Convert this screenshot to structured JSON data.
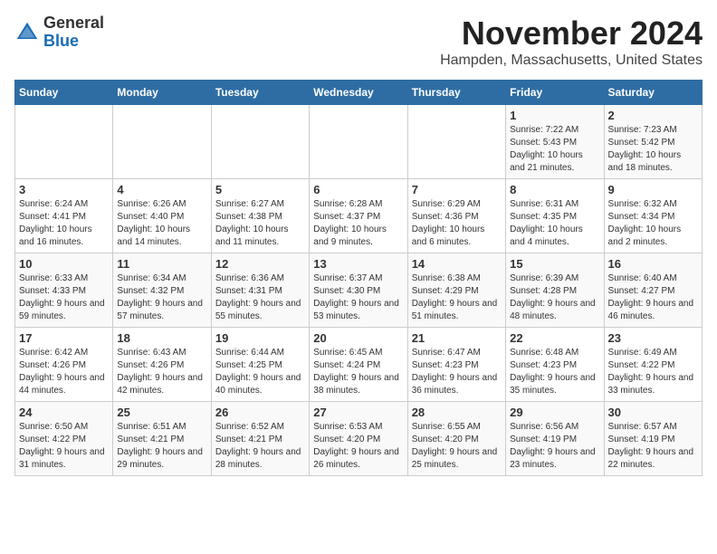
{
  "header": {
    "logo_general": "General",
    "logo_blue": "Blue",
    "month_title": "November 2024",
    "location": "Hampden, Massachusetts, United States"
  },
  "days_of_week": [
    "Sunday",
    "Monday",
    "Tuesday",
    "Wednesday",
    "Thursday",
    "Friday",
    "Saturday"
  ],
  "weeks": [
    [
      {
        "day": "",
        "info": ""
      },
      {
        "day": "",
        "info": ""
      },
      {
        "day": "",
        "info": ""
      },
      {
        "day": "",
        "info": ""
      },
      {
        "day": "",
        "info": ""
      },
      {
        "day": "1",
        "info": "Sunrise: 7:22 AM\nSunset: 5:43 PM\nDaylight: 10 hours and 21 minutes."
      },
      {
        "day": "2",
        "info": "Sunrise: 7:23 AM\nSunset: 5:42 PM\nDaylight: 10 hours and 18 minutes."
      }
    ],
    [
      {
        "day": "3",
        "info": "Sunrise: 6:24 AM\nSunset: 4:41 PM\nDaylight: 10 hours and 16 minutes."
      },
      {
        "day": "4",
        "info": "Sunrise: 6:26 AM\nSunset: 4:40 PM\nDaylight: 10 hours and 14 minutes."
      },
      {
        "day": "5",
        "info": "Sunrise: 6:27 AM\nSunset: 4:38 PM\nDaylight: 10 hours and 11 minutes."
      },
      {
        "day": "6",
        "info": "Sunrise: 6:28 AM\nSunset: 4:37 PM\nDaylight: 10 hours and 9 minutes."
      },
      {
        "day": "7",
        "info": "Sunrise: 6:29 AM\nSunset: 4:36 PM\nDaylight: 10 hours and 6 minutes."
      },
      {
        "day": "8",
        "info": "Sunrise: 6:31 AM\nSunset: 4:35 PM\nDaylight: 10 hours and 4 minutes."
      },
      {
        "day": "9",
        "info": "Sunrise: 6:32 AM\nSunset: 4:34 PM\nDaylight: 10 hours and 2 minutes."
      }
    ],
    [
      {
        "day": "10",
        "info": "Sunrise: 6:33 AM\nSunset: 4:33 PM\nDaylight: 9 hours and 59 minutes."
      },
      {
        "day": "11",
        "info": "Sunrise: 6:34 AM\nSunset: 4:32 PM\nDaylight: 9 hours and 57 minutes."
      },
      {
        "day": "12",
        "info": "Sunrise: 6:36 AM\nSunset: 4:31 PM\nDaylight: 9 hours and 55 minutes."
      },
      {
        "day": "13",
        "info": "Sunrise: 6:37 AM\nSunset: 4:30 PM\nDaylight: 9 hours and 53 minutes."
      },
      {
        "day": "14",
        "info": "Sunrise: 6:38 AM\nSunset: 4:29 PM\nDaylight: 9 hours and 51 minutes."
      },
      {
        "day": "15",
        "info": "Sunrise: 6:39 AM\nSunset: 4:28 PM\nDaylight: 9 hours and 48 minutes."
      },
      {
        "day": "16",
        "info": "Sunrise: 6:40 AM\nSunset: 4:27 PM\nDaylight: 9 hours and 46 minutes."
      }
    ],
    [
      {
        "day": "17",
        "info": "Sunrise: 6:42 AM\nSunset: 4:26 PM\nDaylight: 9 hours and 44 minutes."
      },
      {
        "day": "18",
        "info": "Sunrise: 6:43 AM\nSunset: 4:26 PM\nDaylight: 9 hours and 42 minutes."
      },
      {
        "day": "19",
        "info": "Sunrise: 6:44 AM\nSunset: 4:25 PM\nDaylight: 9 hours and 40 minutes."
      },
      {
        "day": "20",
        "info": "Sunrise: 6:45 AM\nSunset: 4:24 PM\nDaylight: 9 hours and 38 minutes."
      },
      {
        "day": "21",
        "info": "Sunrise: 6:47 AM\nSunset: 4:23 PM\nDaylight: 9 hours and 36 minutes."
      },
      {
        "day": "22",
        "info": "Sunrise: 6:48 AM\nSunset: 4:23 PM\nDaylight: 9 hours and 35 minutes."
      },
      {
        "day": "23",
        "info": "Sunrise: 6:49 AM\nSunset: 4:22 PM\nDaylight: 9 hours and 33 minutes."
      }
    ],
    [
      {
        "day": "24",
        "info": "Sunrise: 6:50 AM\nSunset: 4:22 PM\nDaylight: 9 hours and 31 minutes."
      },
      {
        "day": "25",
        "info": "Sunrise: 6:51 AM\nSunset: 4:21 PM\nDaylight: 9 hours and 29 minutes."
      },
      {
        "day": "26",
        "info": "Sunrise: 6:52 AM\nSunset: 4:21 PM\nDaylight: 9 hours and 28 minutes."
      },
      {
        "day": "27",
        "info": "Sunrise: 6:53 AM\nSunset: 4:20 PM\nDaylight: 9 hours and 26 minutes."
      },
      {
        "day": "28",
        "info": "Sunrise: 6:55 AM\nSunset: 4:20 PM\nDaylight: 9 hours and 25 minutes."
      },
      {
        "day": "29",
        "info": "Sunrise: 6:56 AM\nSunset: 4:19 PM\nDaylight: 9 hours and 23 minutes."
      },
      {
        "day": "30",
        "info": "Sunrise: 6:57 AM\nSunset: 4:19 PM\nDaylight: 9 hours and 22 minutes."
      }
    ]
  ]
}
